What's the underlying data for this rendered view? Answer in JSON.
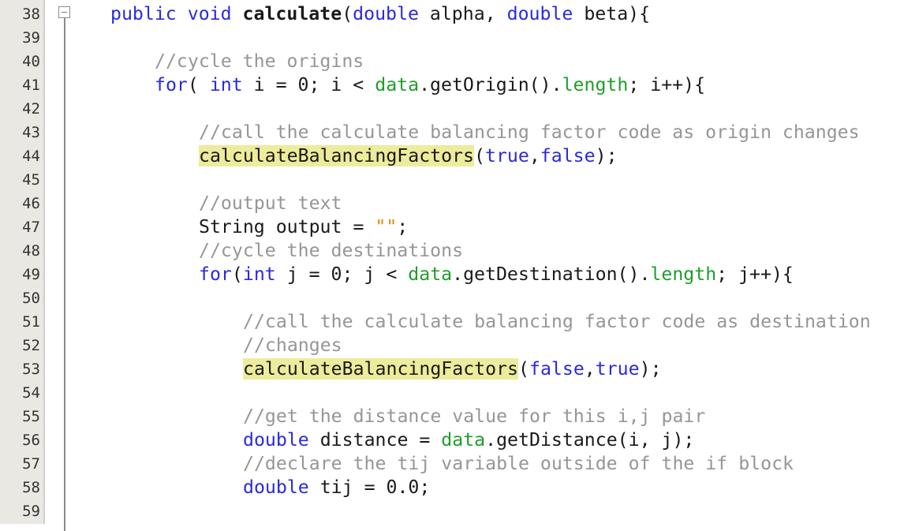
{
  "editor": {
    "line_numbers": [
      "38",
      "39",
      "40",
      "41",
      "42",
      "43",
      "44",
      "45",
      "46",
      "47",
      "48",
      "49",
      "50",
      "51",
      "52",
      "53",
      "54",
      "55",
      "56",
      "57",
      "58",
      "59"
    ],
    "lines": [
      {
        "n": "38",
        "indent": 1,
        "tokens": [
          {
            "t": "public",
            "c": "kw"
          },
          {
            "t": " "
          },
          {
            "t": "void",
            "c": "kw"
          },
          {
            "t": " "
          },
          {
            "t": "calculate",
            "c": "bold"
          },
          {
            "t": "("
          },
          {
            "t": "double",
            "c": "kw"
          },
          {
            "t": " alpha, "
          },
          {
            "t": "double",
            "c": "kw"
          },
          {
            "t": " beta){"
          }
        ]
      },
      {
        "n": "39",
        "indent": 0,
        "tokens": []
      },
      {
        "n": "40",
        "indent": 2,
        "tokens": [
          {
            "t": "//cycle the origins",
            "c": "cm"
          }
        ]
      },
      {
        "n": "41",
        "indent": 2,
        "tokens": [
          {
            "t": "for",
            "c": "kw"
          },
          {
            "t": "( "
          },
          {
            "t": "int",
            "c": "kw"
          },
          {
            "t": " i = 0; i < "
          },
          {
            "t": "data",
            "c": "fld"
          },
          {
            "t": ".getOrigin()."
          },
          {
            "t": "length",
            "c": "fld"
          },
          {
            "t": "; i++){"
          }
        ]
      },
      {
        "n": "42",
        "indent": 0,
        "tokens": []
      },
      {
        "n": "43",
        "indent": 3,
        "tokens": [
          {
            "t": "//call the calculate balancing factor code as origin changes",
            "c": "cm"
          }
        ]
      },
      {
        "n": "44",
        "indent": 3,
        "tokens": [
          {
            "t": "calculateBalancingFactors",
            "c": "hl"
          },
          {
            "t": "("
          },
          {
            "t": "true",
            "c": "kw"
          },
          {
            "t": ","
          },
          {
            "t": "false",
            "c": "kw"
          },
          {
            "t": ");"
          }
        ]
      },
      {
        "n": "45",
        "indent": 0,
        "tokens": []
      },
      {
        "n": "46",
        "indent": 3,
        "tokens": [
          {
            "t": "//output text",
            "c": "cm"
          }
        ]
      },
      {
        "n": "47",
        "indent": 3,
        "tokens": [
          {
            "t": "String output = "
          },
          {
            "t": "\"\"",
            "c": "str"
          },
          {
            "t": ";"
          }
        ]
      },
      {
        "n": "48",
        "indent": 3,
        "tokens": [
          {
            "t": "//cycle the destinations",
            "c": "cm"
          }
        ]
      },
      {
        "n": "49",
        "indent": 3,
        "tokens": [
          {
            "t": "for",
            "c": "kw"
          },
          {
            "t": "("
          },
          {
            "t": "int",
            "c": "kw"
          },
          {
            "t": " j = 0; j < "
          },
          {
            "t": "data",
            "c": "fld"
          },
          {
            "t": ".getDestination()."
          },
          {
            "t": "length",
            "c": "fld"
          },
          {
            "t": "; j++){"
          }
        ]
      },
      {
        "n": "50",
        "indent": 0,
        "tokens": []
      },
      {
        "n": "51",
        "indent": 4,
        "tokens": [
          {
            "t": "//call the calculate balancing factor code as destination",
            "c": "cm"
          }
        ]
      },
      {
        "n": "52",
        "indent": 4,
        "tokens": [
          {
            "t": "//changes",
            "c": "cm"
          }
        ]
      },
      {
        "n": "53",
        "indent": 4,
        "tokens": [
          {
            "t": "calculateBalancingFactors",
            "c": "hl"
          },
          {
            "t": "("
          },
          {
            "t": "false",
            "c": "kw"
          },
          {
            "t": ","
          },
          {
            "t": "true",
            "c": "kw"
          },
          {
            "t": ");"
          }
        ]
      },
      {
        "n": "54",
        "indent": 0,
        "tokens": []
      },
      {
        "n": "55",
        "indent": 4,
        "tokens": [
          {
            "t": "//get the distance value for this i,j pair",
            "c": "cm"
          }
        ]
      },
      {
        "n": "56",
        "indent": 4,
        "tokens": [
          {
            "t": "double",
            "c": "kw"
          },
          {
            "t": " distance = "
          },
          {
            "t": "data",
            "c": "fld"
          },
          {
            "t": ".getDistance(i, j);"
          }
        ]
      },
      {
        "n": "57",
        "indent": 4,
        "tokens": [
          {
            "t": "//declare the tij variable outside of the if block",
            "c": "cm"
          }
        ]
      },
      {
        "n": "58",
        "indent": 4,
        "tokens": [
          {
            "t": "double",
            "c": "kw"
          },
          {
            "t": " tij = 0.0;"
          }
        ]
      },
      {
        "n": "59",
        "indent": 0,
        "tokens": []
      }
    ],
    "colors": {
      "keyword": "#2a2ae0",
      "comment": "#969696",
      "field": "#1f9e2a",
      "string": "#e08a00",
      "highlight": "#ecec9c",
      "gutter": "#e9e8e2"
    }
  }
}
